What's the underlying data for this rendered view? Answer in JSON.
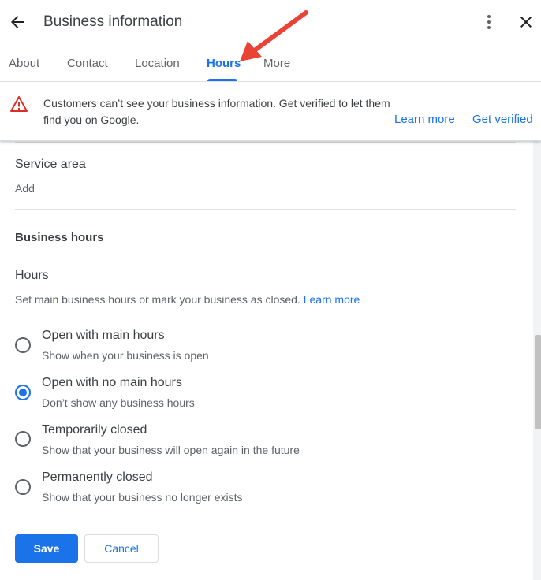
{
  "header": {
    "title": "Business information",
    "back_icon": "arrow-left-icon",
    "more_icon": "more-vertical-icon",
    "close_icon": "close-icon"
  },
  "tabs": [
    {
      "label": "About",
      "active": false
    },
    {
      "label": "Contact",
      "active": false
    },
    {
      "label": "Location",
      "active": false
    },
    {
      "label": "Hours",
      "active": true
    },
    {
      "label": "More",
      "active": false
    }
  ],
  "banner": {
    "icon": "warning-icon",
    "text": "Customers can’t see your business information. Get verified to let them find you on Google.",
    "learn_more": "Learn more",
    "get_verified": "Get verified"
  },
  "service_area": {
    "label": "Service area",
    "value": "Add"
  },
  "business_hours": {
    "section_title": "Business hours",
    "hours_label": "Hours",
    "description": "Set main business hours or mark your business as closed.",
    "learn_more": "Learn more",
    "selected": "open_no_main_hours",
    "options": [
      {
        "id": "open_main_hours",
        "title": "Open with main hours",
        "subtitle": "Show when your business is open"
      },
      {
        "id": "open_no_main_hours",
        "title": "Open with no main hours",
        "subtitle": "Don’t show any business hours"
      },
      {
        "id": "temporarily_closed",
        "title": "Temporarily closed",
        "subtitle": "Show that your business will open again in the future"
      },
      {
        "id": "permanently_closed",
        "title": "Permanently closed",
        "subtitle": "Show that your business no longer exists"
      }
    ]
  },
  "actions": {
    "save": "Save",
    "cancel": "Cancel"
  },
  "colors": {
    "accent": "#1a73e8",
    "warning": "#d93025",
    "annotation_arrow": "#ea4335"
  }
}
